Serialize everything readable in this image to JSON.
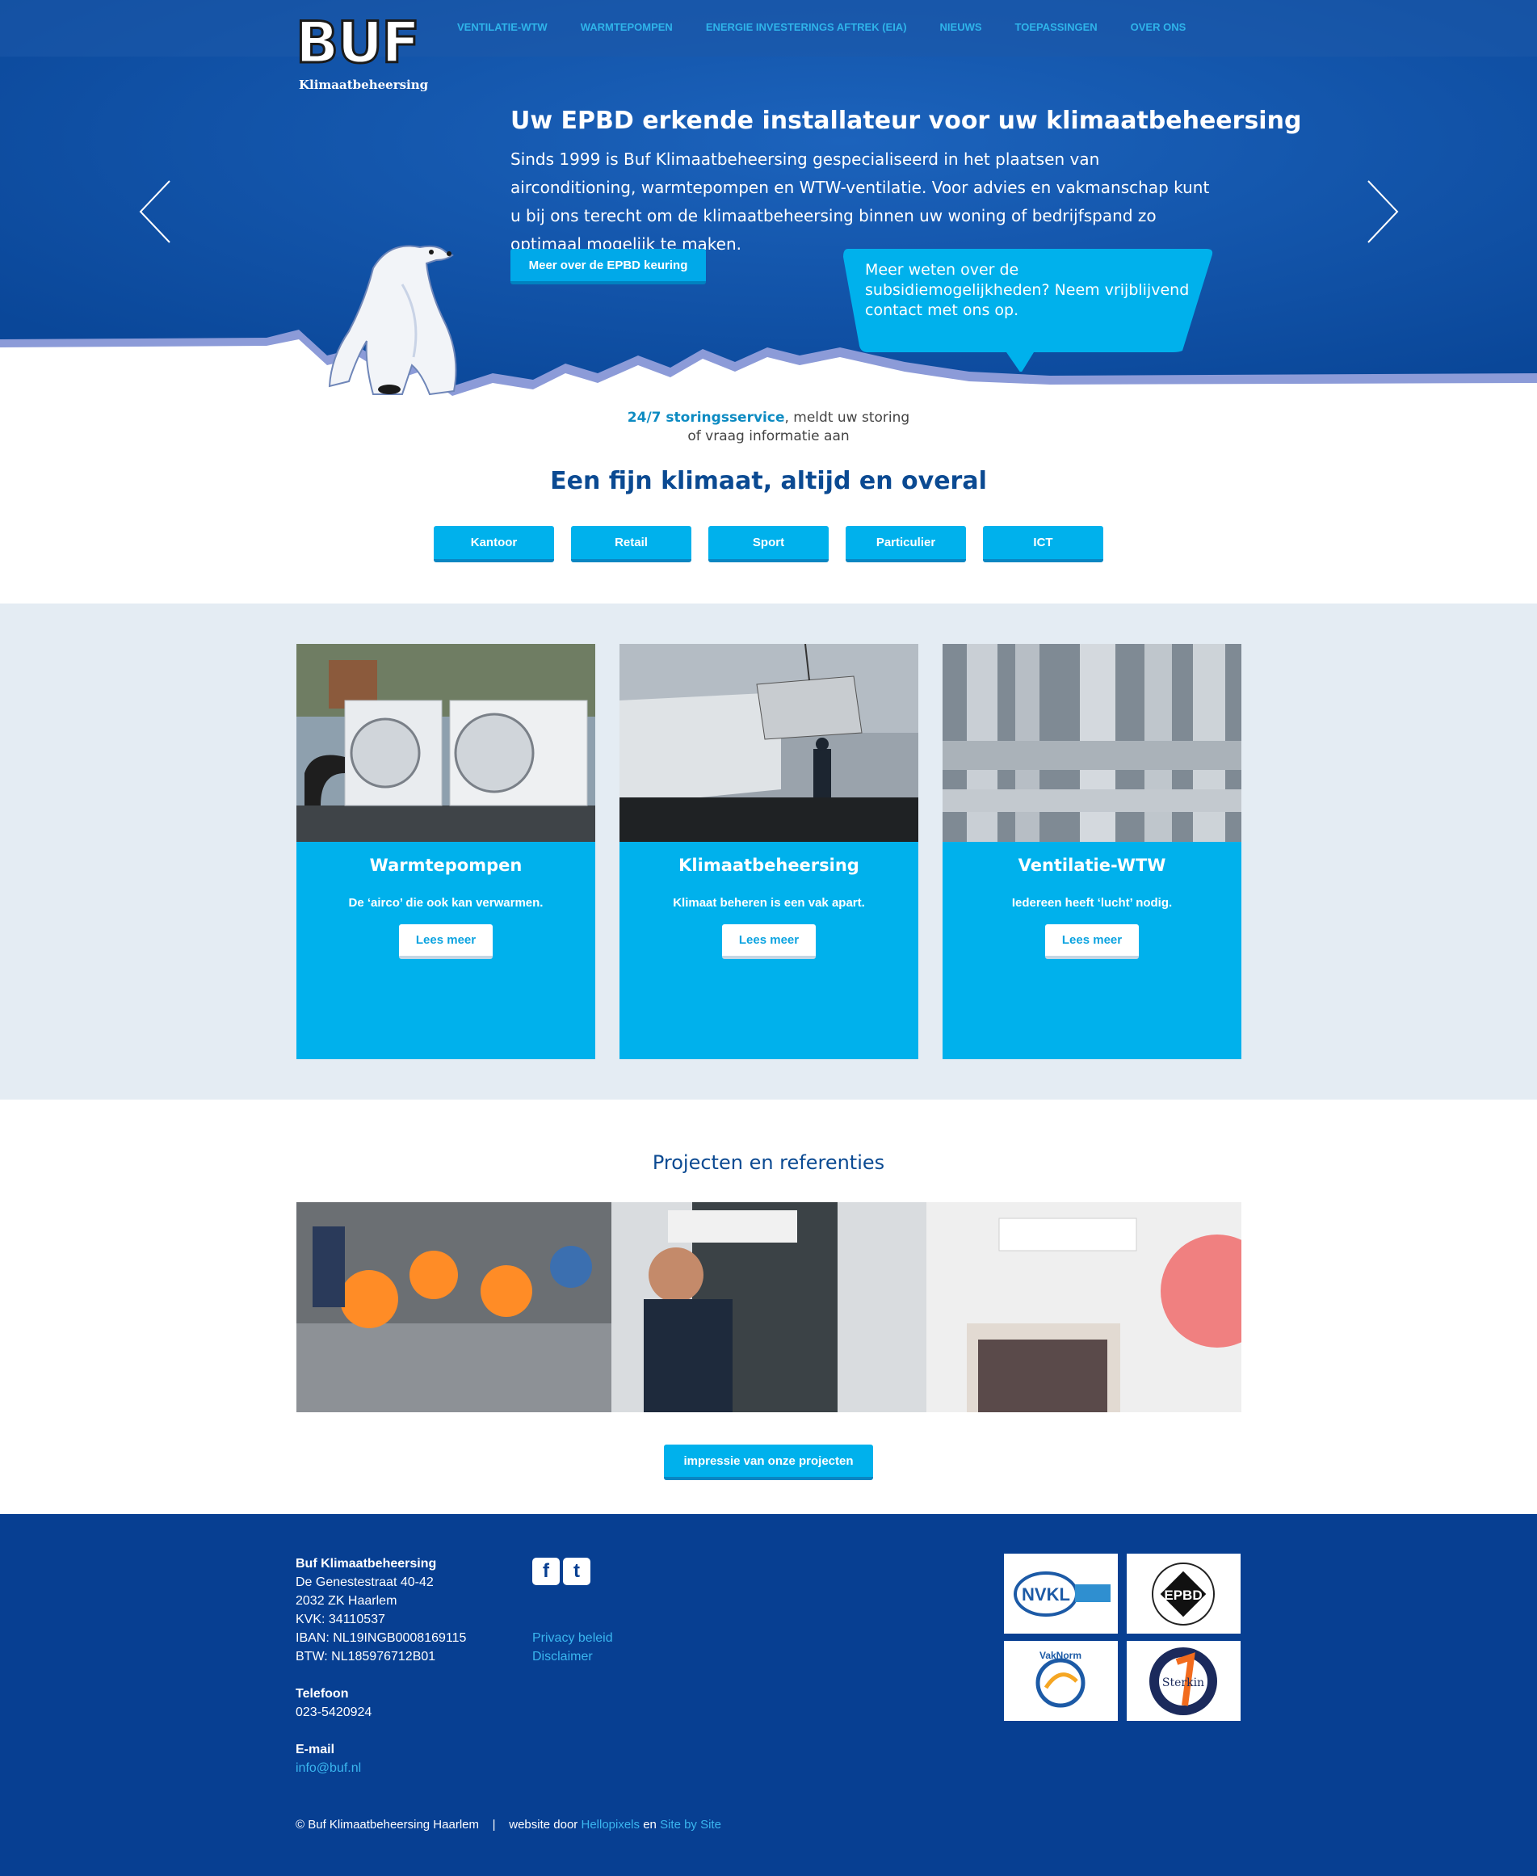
{
  "brand": {
    "name": "BUF",
    "tagline": "Klimaatbeheersing"
  },
  "nav": {
    "items": [
      "Ventilatie-WTW",
      "Warmtepompen",
      "Energie Investerings Aftrek (EIA)",
      "Nieuws",
      "Toepassingen",
      "Over ons"
    ]
  },
  "hero": {
    "title": "Uw EPBD erkende installateur voor uw klimaatbeheersing",
    "text": "Sinds 1999 is Buf Klimaatbeheersing gespecialiseerd in het plaatsen van airconditioning, warmtepompen en WTW-ventilatie. Voor advies en vakmanschap kunt u bij ons terecht om de klimaatbeheersing binnen uw woning of bedrijfspand zo optimaal mogelijk te maken.",
    "button": "Meer over de EPBD keuring",
    "bubble": "Meer weten over de subsidiemogelijkheden? Neem vrijblijvend contact met ons op."
  },
  "intro": {
    "storing_highlight": "24/7 storingsservice",
    "storing_rest": ", meldt uw storing",
    "storing_line2": "of vraag informatie aan",
    "title": "Een fijn klimaat, altijd en overal",
    "categories": [
      "Kantoor",
      "Retail",
      "Sport",
      "Particulier",
      "ICT"
    ]
  },
  "services": [
    {
      "title": "Warmtepompen",
      "subtitle": "De ‘airco’ die ook kan verwarmen.",
      "button": "Lees meer"
    },
    {
      "title": "Klimaatbeheersing",
      "subtitle": "Klimaat beheren is een vak apart.",
      "button": "Lees meer"
    },
    {
      "title": "Ventilatie-WTW",
      "subtitle": "Iedereen heeft ‘lucht’ nodig.",
      "button": "Lees meer"
    }
  ],
  "projects": {
    "title": "Projecten en referenties",
    "button": "impressie van onze projecten"
  },
  "footer": {
    "company": "Buf Klimaatbeheersing",
    "address": [
      "De Genestestraat 40-42",
      "2032 ZK Haarlem",
      "KVK: 34110537",
      "IBAN: NL19INGB0008169115",
      "BTW: NL185976712B01"
    ],
    "phone_label": "Telefoon",
    "phone": "023-5420924",
    "email_label": "E-mail",
    "email": "info@buf.nl",
    "social": [
      "f",
      "t"
    ],
    "links": [
      "Privacy beleid",
      "Disclaimer"
    ],
    "certificates": [
      "NVKL",
      "EPBD",
      "VakNorm",
      "Sterkin"
    ],
    "copyright": "© Buf Klimaatbeheersing Haarlem",
    "separator": "|",
    "credit_prefix": "website door",
    "credit_link1": "Hellopixels",
    "credit_and": "en",
    "credit_link2": "Site by Site"
  },
  "colors": {
    "hero_blue": "#0a4fa6",
    "accent": "#00b1ec",
    "footer_blue": "#073f92",
    "heading_blue": "#0b4a92",
    "services_bg": "#e4ecf3"
  }
}
